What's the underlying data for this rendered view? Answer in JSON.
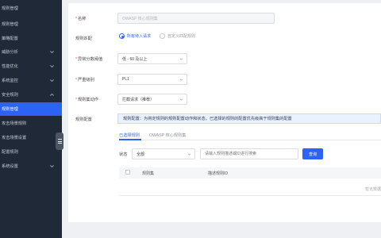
{
  "sidebar": {
    "items": [
      {
        "label": "规则管理"
      },
      {
        "label": "规则管理"
      },
      {
        "label": "策略配置"
      },
      {
        "label": "威胁分析"
      },
      {
        "label": "性能优化"
      },
      {
        "label": "系统监控"
      },
      {
        "label": "安全规则"
      },
      {
        "label": "规则管理"
      },
      {
        "label": "攻击场景规则"
      },
      {
        "label": "攻击场景设置"
      },
      {
        "label": "配置规则"
      },
      {
        "label": "系统设置"
      }
    ]
  },
  "form": {
    "name_label": "名称",
    "name_value": "OWASP 核心规则集",
    "rule_match_label": "规则匹配",
    "radio_all": "所有待入请求",
    "radio_custom": "自定义匹配规则",
    "threshold_label": "异常分数阈值",
    "threshold_value": "低 - 60 及以上",
    "severity_label": "严重级别",
    "severity_value": "PL1",
    "action_label": "规则集动作",
    "action_value": "拦截请求（推荐）",
    "config_label": "规则配置",
    "notice": "规则配置：为将定规则的规则配置动作和状态，已选择的规则的配置优先级高于规则集的配置"
  },
  "tabs": [
    {
      "label": "已选择规则"
    },
    {
      "label": "OWASP 核心规则集"
    }
  ],
  "filter": {
    "status_label": "状态",
    "status_value": "全部",
    "search_placeholder": "请输入规则描述或ID进行搜索",
    "query_button": "查询"
  },
  "table": {
    "columns": [
      "规则集",
      "描述规则ID"
    ],
    "empty_text": "暂无数据"
  },
  "colors": {
    "accent": "#2d63f4",
    "sidebar_bg": "#1f2937"
  }
}
